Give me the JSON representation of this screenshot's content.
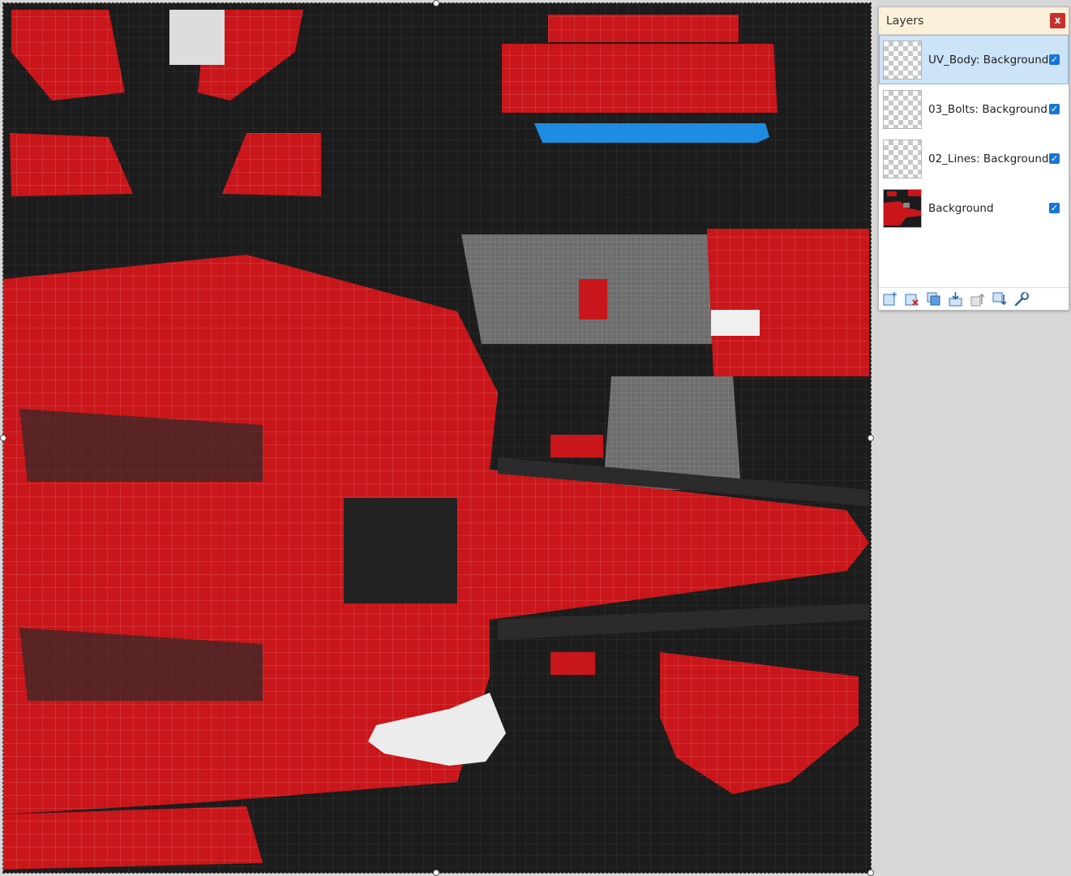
{
  "layers_panel": {
    "title": "Layers",
    "close_label": "x",
    "layers": [
      {
        "name": "UV_Body: Background",
        "visible": true,
        "selected": true
      },
      {
        "name": "03_Bolts: Background",
        "visible": true,
        "selected": false
      },
      {
        "name": "02_Lines: Background",
        "visible": true,
        "selected": false
      },
      {
        "name": "Background",
        "visible": true,
        "selected": false
      }
    ],
    "toolbar_icons": [
      "add-layer-icon",
      "delete-layer-icon",
      "duplicate-layer-icon",
      "merge-down-icon",
      "move-layer-up-icon",
      "move-layer-down-icon",
      "layer-properties-icon"
    ]
  },
  "colors": {
    "canvas_dark": "#1c1c1c",
    "uv_red": "#c8161a",
    "uv_gray": "#7a7a7a",
    "uv_blue": "#1e8ce0",
    "panel_header": "#fbf0d9",
    "selection": "#cde3f8"
  }
}
